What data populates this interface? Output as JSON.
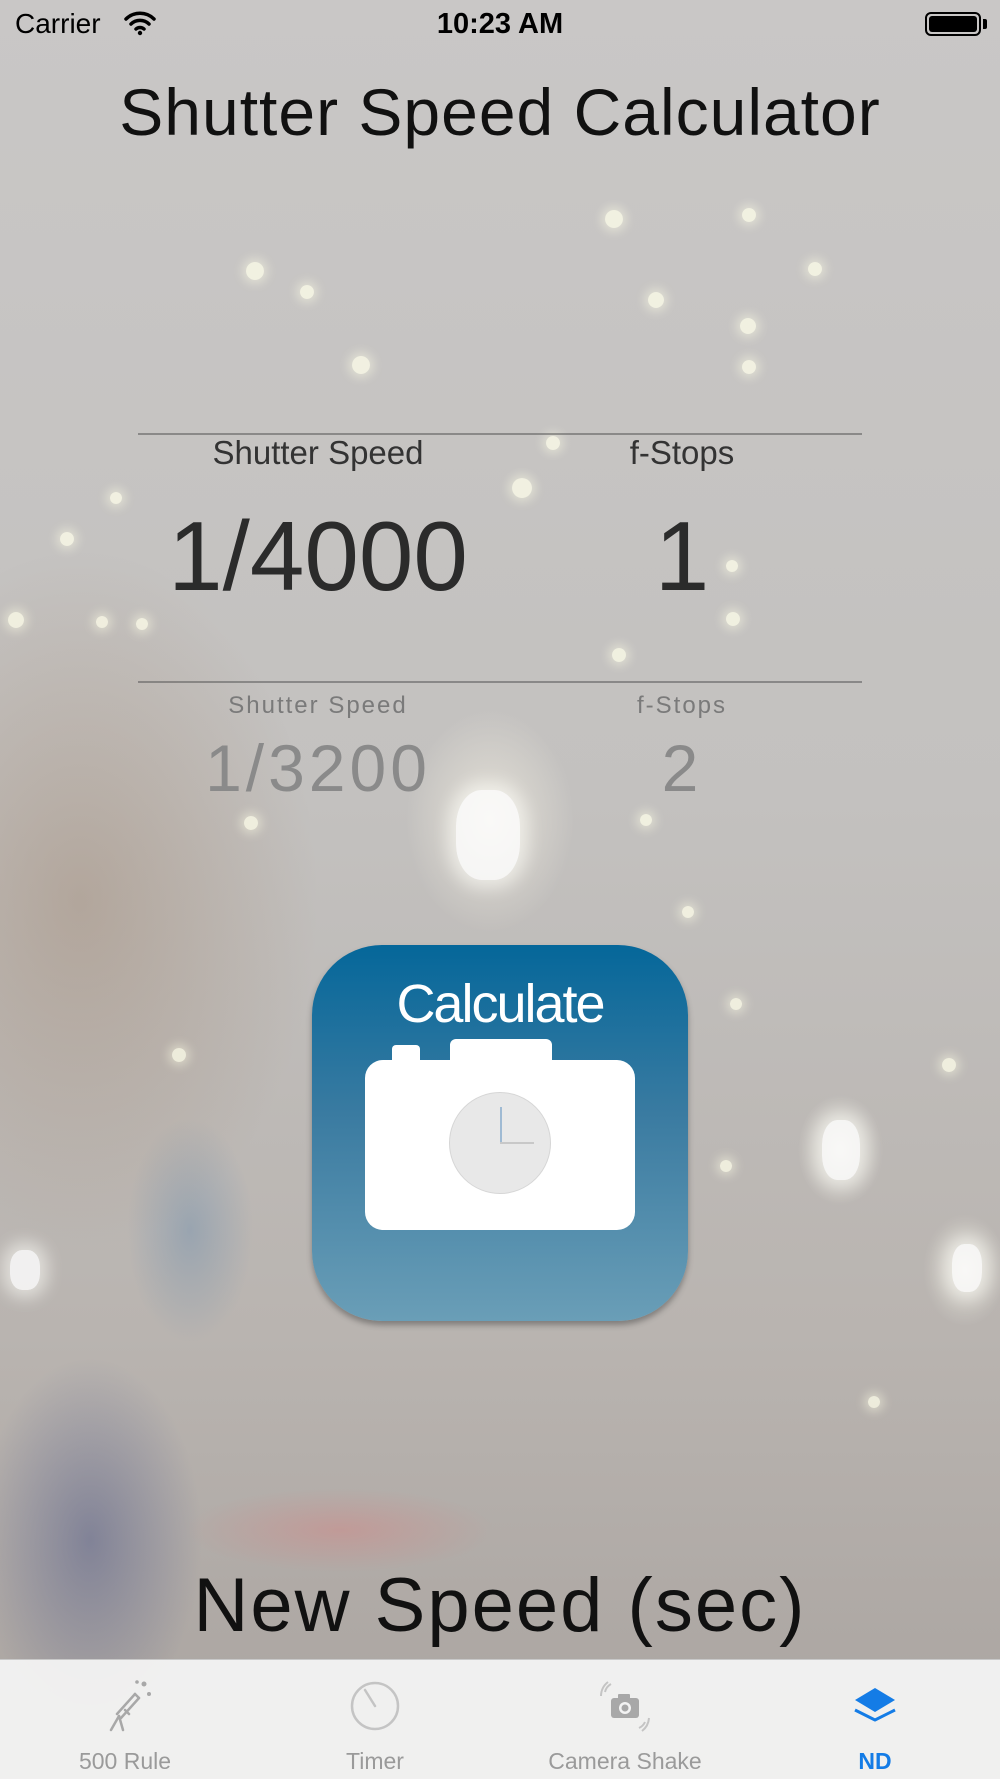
{
  "status_bar": {
    "carrier": "Carrier",
    "time": "10:23 AM"
  },
  "title": "Shutter Speed Calculator",
  "picker": {
    "selected": {
      "shutter_label": "Shutter Speed",
      "shutter_value": "1/4000",
      "fstops_label": "f-Stops",
      "fstops_value": "1"
    },
    "next": {
      "shutter_label": "Shutter Speed",
      "shutter_value": "1/3200",
      "fstops_label": "f-Stops",
      "fstops_value": "2"
    }
  },
  "calculate_button": {
    "label": "Calculate"
  },
  "result_label": "New Speed (sec)",
  "tab_bar": {
    "tabs": [
      {
        "label": "500 Rule",
        "icon": "telescope-icon",
        "active": false
      },
      {
        "label": "Timer",
        "icon": "timer-icon",
        "active": false
      },
      {
        "label": "Camera Shake",
        "icon": "camera-shake-icon",
        "active": false
      },
      {
        "label": "ND",
        "icon": "layers-icon",
        "active": true
      }
    ],
    "active_color": "#147ce6",
    "inactive_color": "#9a9a9a"
  },
  "colors": {
    "button_top": "#05679a",
    "button_bottom": "#6a9eb7"
  }
}
